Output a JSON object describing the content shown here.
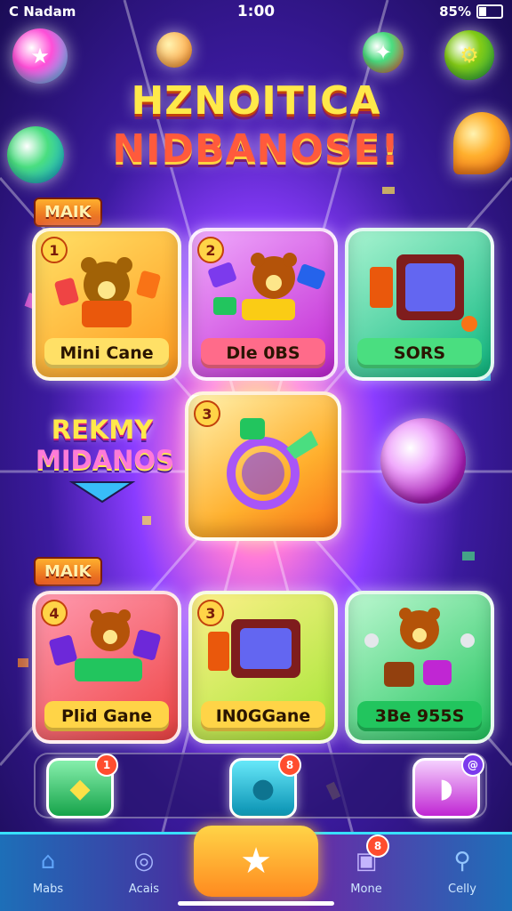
{
  "status": {
    "carrier": "C Nadam",
    "time": "1:00",
    "battery": "85%"
  },
  "title": {
    "line1": "HZNOITICA",
    "line2": "NIDBANOSE!"
  },
  "sections": [
    {
      "tag": "MAIK"
    },
    {
      "tag": "MAIK"
    }
  ],
  "top_cards": [
    {
      "num": "1",
      "label": "Mini Cane",
      "bg": "#ffb02e",
      "label_bg": "#ffe066"
    },
    {
      "num": "2",
      "label": "Dle 0BS",
      "bg": "#d946ef",
      "label_bg": "#ff6b8a"
    },
    {
      "num": "",
      "label": "SORS",
      "bg": "#34d399",
      "label_bg": "#4ade80"
    }
  ],
  "center_card": {
    "num": "3"
  },
  "promo": {
    "line1": "REKMY",
    "line2": "MIDANOS"
  },
  "bottom_cards": [
    {
      "num": "4",
      "label": "Plid Gane",
      "bg": "#fb5b7a",
      "label_bg": "#ffd447"
    },
    {
      "num": "3",
      "label": "IN0GGane",
      "bg": "#fde047",
      "label_bg": "#ffd447"
    },
    {
      "num": "",
      "label": "3Be 955S",
      "bg": "#4ade80",
      "label_bg": "#22c55e"
    }
  ],
  "tray": [
    {
      "icon": "chat-bubble-icon",
      "badge": "1"
    },
    {
      "icon": "game-controller-icon",
      "badge": "8"
    },
    {
      "icon": "ghost-chat-icon",
      "badge": "@"
    }
  ],
  "nav": [
    {
      "label": "Mabs",
      "icon": "home-icon"
    },
    {
      "label": "Acais",
      "icon": "controller-icon"
    },
    {
      "label": "",
      "icon": "star-icon"
    },
    {
      "label": "Mone",
      "icon": "chest-icon",
      "badge": "8"
    },
    {
      "label": "Celly",
      "icon": "search-icon"
    }
  ]
}
